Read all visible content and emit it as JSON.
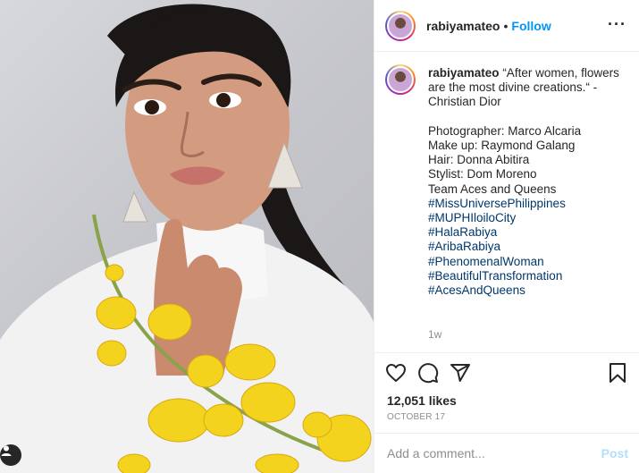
{
  "post": {
    "username": "rabiyamateo",
    "dot": "•",
    "follow_label": "Follow",
    "more_icon": "more-horizontal-icon",
    "caption": {
      "username": "rabiyamateo",
      "lines": [
        "“After women, flowers are the most divine creations.“ -Christian Dior",
        "",
        "Photographer: Marco Alcaria",
        "Make up: Raymond Galang",
        "Hair: Donna Abitira",
        "Stylist: Dom Moreno",
        "Team Aces and Queens",
        ""
      ],
      "hashtags": [
        "#MissUniversePhilippines",
        "#MUPHIloiloCity",
        "#HalaRabiya",
        "#AribaRabiya",
        "#PhenomenalWoman",
        "#BeautifulTransformation",
        "#AcesAndQueens"
      ],
      "time_ago": "1w"
    },
    "likes": "12,051 likes",
    "date": "OCTOBER 17",
    "comment": {
      "placeholder": "Add a comment...",
      "post_label": "Post"
    },
    "colors": {
      "follow": "#0095f6",
      "hashtag": "#00376b",
      "muted": "#8e8e8e",
      "post_disabled": "#b2dffc"
    },
    "icons": [
      "heart-icon",
      "comment-icon",
      "share-icon",
      "bookmark-icon",
      "user-icon"
    ]
  }
}
